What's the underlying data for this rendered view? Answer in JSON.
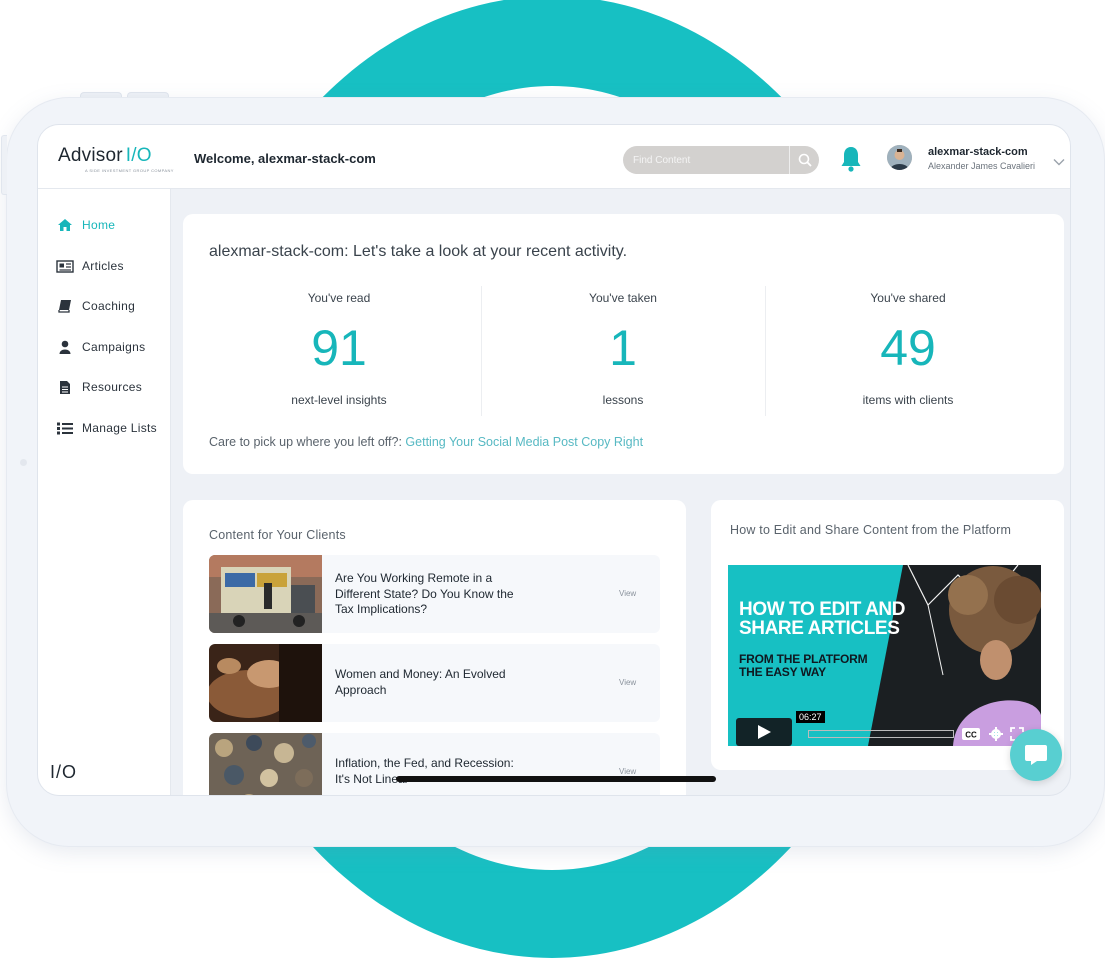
{
  "brand": {
    "logo_text": "Advisor",
    "logo_io": "I/O",
    "logo_sub": "A SIDE INVESTMENT GROUP COMPANY",
    "footer_mark": "I/O",
    "accent": "#17b6ba"
  },
  "header": {
    "welcome": "Welcome, alexmar-stack-com",
    "search_placeholder": "Find Content",
    "search_icon": "search-icon",
    "bell_icon": "bell-icon",
    "user_handle": "alexmar-stack-com",
    "user_fullname": "Alexander James Cavalieri"
  },
  "sidebar": {
    "items": [
      {
        "label": "Home",
        "icon": "home-icon"
      },
      {
        "label": "Articles",
        "icon": "newspaper-icon"
      },
      {
        "label": "Coaching",
        "icon": "book-icon"
      },
      {
        "label": "Campaigns",
        "icon": "user-icon"
      },
      {
        "label": "Resources",
        "icon": "file-icon"
      },
      {
        "label": "Manage Lists",
        "icon": "list-icon"
      }
    ]
  },
  "activity": {
    "title": "alexmar-stack-com: Let's take a look at your recent activity.",
    "stats": [
      {
        "label": "You've read",
        "value": "91",
        "sub": "next-level insights"
      },
      {
        "label": "You've taken",
        "value": "1",
        "sub": "lessons"
      },
      {
        "label": "You've shared",
        "value": "49",
        "sub": "items with clients"
      }
    ],
    "resume_prefix": "Care to pick up where you left off?:",
    "resume_link": "Getting Your Social Media Post Copy Right"
  },
  "clients": {
    "title": "Content for Your Clients",
    "articles": [
      {
        "title": "Are You Working Remote in a Different State? Do You Know the Tax Implications?",
        "action": "View"
      },
      {
        "title": "Women and Money: An Evolved Approach",
        "action": "View"
      },
      {
        "title": "Inflation, the Fed, and Recession: It's Not Linear",
        "action": "View"
      }
    ]
  },
  "video": {
    "title": "How to Edit and Share Content from the Platform",
    "headline_1": "HOW TO EDIT AND",
    "headline_2": "SHARE ARTICLES",
    "sub_1": "FROM THE PLATFORM",
    "sub_2": "THE EASY WAY",
    "duration": "06:27",
    "cc": "CC"
  }
}
